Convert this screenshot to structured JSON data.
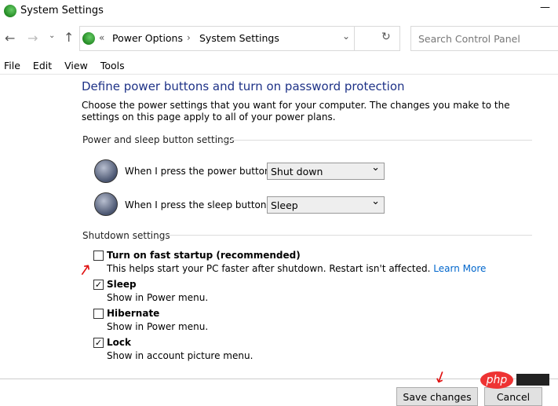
{
  "window": {
    "title": "System Settings",
    "minimize": "—"
  },
  "address": {
    "prefix": "«",
    "crumbs": [
      "Power Options",
      "System Settings"
    ],
    "sep": "›"
  },
  "search": {
    "placeholder": "Search Control Panel"
  },
  "menu": [
    "File",
    "Edit",
    "View",
    "Tools"
  ],
  "page": {
    "heading": "Define power buttons and turn on password protection",
    "description": "Choose the power settings that you want for your computer. The changes you make to the settings on this page apply to all of your power plans."
  },
  "power_section": {
    "label": "Power and sleep button settings",
    "power_label": "When I press the power button:",
    "power_value": "Shut down",
    "sleep_label": "When I press the sleep button:",
    "sleep_value": "Sleep"
  },
  "shutdown_section": {
    "label": "Shutdown settings",
    "items": [
      {
        "title": "Turn on fast startup (recommended)",
        "desc": "This helps start your PC faster after shutdown. Restart isn't affected.",
        "link": "Learn More",
        "checked": false
      },
      {
        "title": "Sleep",
        "desc": "Show in Power menu.",
        "checked": true
      },
      {
        "title": "Hibernate",
        "desc": "Show in Power menu.",
        "checked": false
      },
      {
        "title": "Lock",
        "desc": "Show in account picture menu.",
        "checked": true
      }
    ]
  },
  "buttons": {
    "save": "Save changes",
    "cancel": "Cancel"
  },
  "watermark": "php",
  "colors": {
    "heading": "#1e3287",
    "link": "#0066cc",
    "annotation": "#e01010"
  }
}
